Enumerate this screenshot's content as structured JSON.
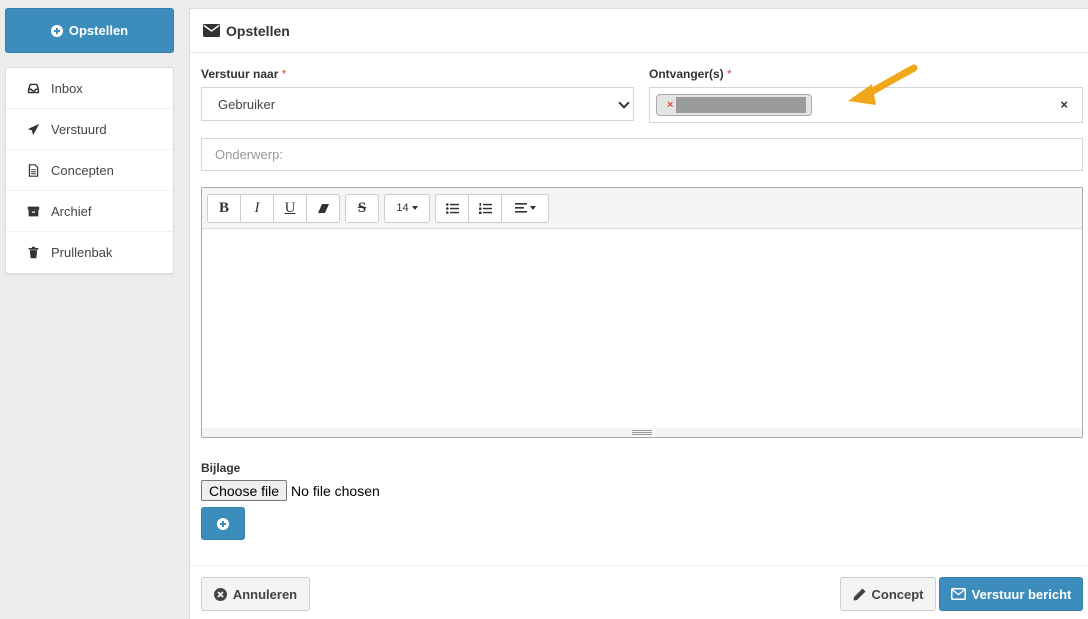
{
  "sidebar": {
    "compose_label": "Opstellen",
    "folders": [
      {
        "label": "Inbox",
        "icon": "inbox-icon"
      },
      {
        "label": "Verstuurd",
        "icon": "paper-plane-icon"
      },
      {
        "label": "Concepten",
        "icon": "file-text-icon"
      },
      {
        "label": "Archief",
        "icon": "archive-icon"
      },
      {
        "label": "Prullenbak",
        "icon": "trash-icon"
      }
    ]
  },
  "header": {
    "title": "Opstellen",
    "icon": "envelope-icon"
  },
  "form": {
    "send_to_label": "Verstuur naar",
    "send_to_value": "Gebruiker",
    "recipients_label": "Ontvanger(s)",
    "required_mark": "*",
    "recipient_chip_remove": "×",
    "clear_recipients": "×",
    "subject_placeholder": "Onderwerp:",
    "attachment_label": "Bijlage",
    "choose_file_label": "Choose file",
    "file_status": "No file chosen"
  },
  "editor_toolbar": {
    "bold": "B",
    "italic": "I",
    "underline": "U",
    "strike": "S",
    "font_size": "14"
  },
  "footer": {
    "cancel_label": "Annuleren",
    "draft_label": "Concept",
    "send_label": "Verstuur bericht"
  },
  "colors": {
    "primary": "#3c8dbc",
    "required": "#dd4b39",
    "arrow": "#f0a818"
  }
}
